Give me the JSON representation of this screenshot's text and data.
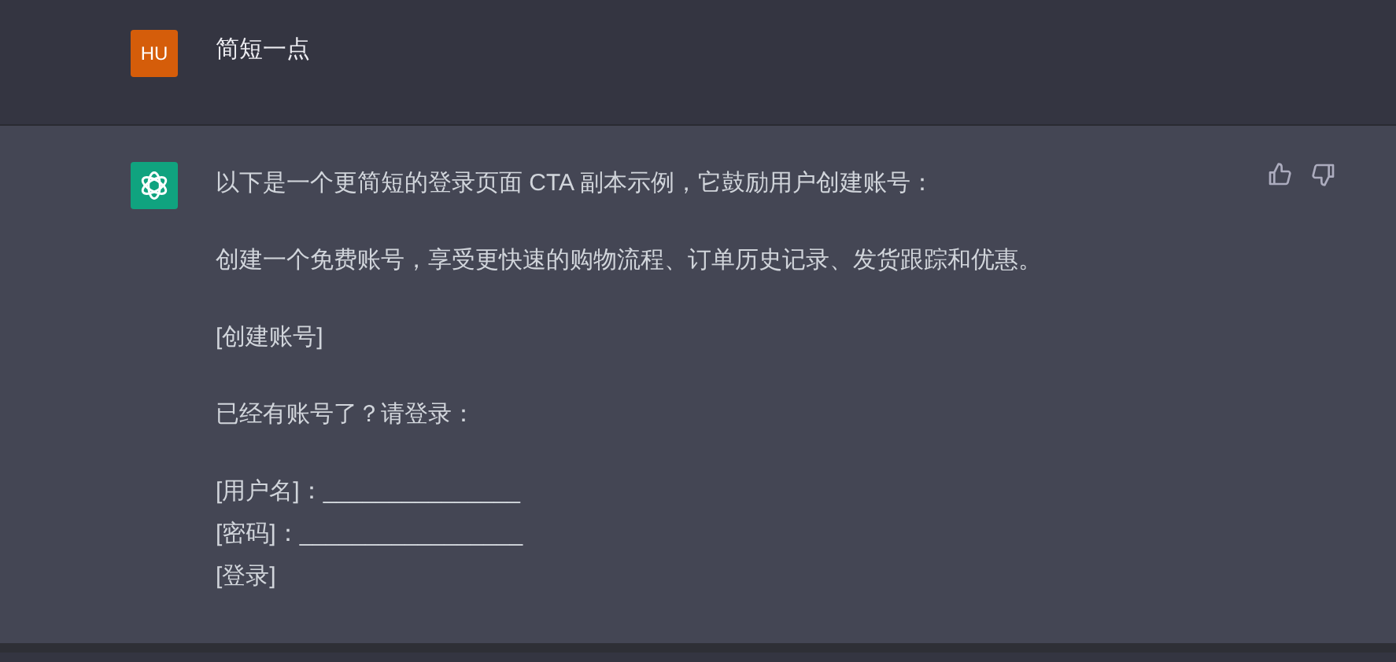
{
  "user_message": {
    "avatar": "HU",
    "text": "简短一点"
  },
  "assistant_message": {
    "paragraphs": [
      [
        "以下是一个更简短的登录页面 CTA 副本示例，它鼓励用户创建账号："
      ],
      [
        "创建一个免费账号，享受更快速的购物流程、订单历史记录、发货跟踪和优惠。"
      ],
      [
        "[创建账号]"
      ],
      [
        "已经有账号了？请登录："
      ],
      [
        "[用户名]：_______________",
        "[密码]：_________________",
        "[登录]"
      ]
    ]
  }
}
